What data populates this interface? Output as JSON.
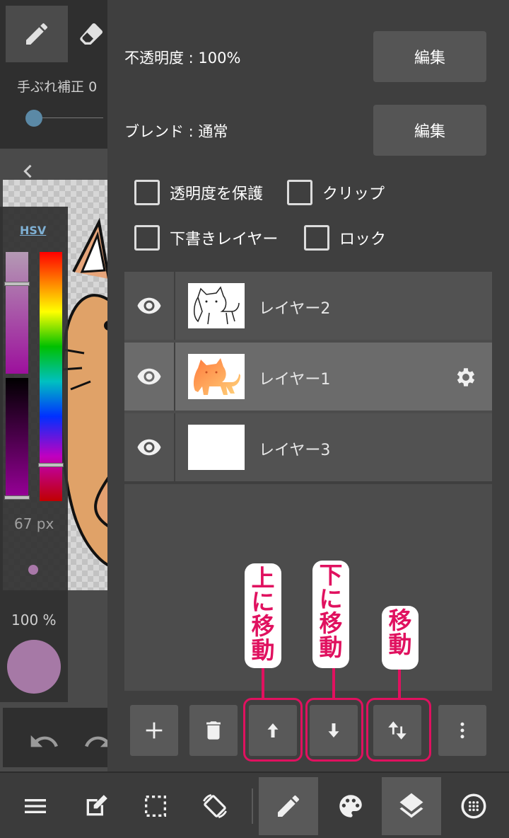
{
  "colors": {
    "accent_callout": "#e0115f",
    "panel_bg": "#3f3f3f",
    "selected_layer": "#6b6b6b",
    "current_color": "#a679a6",
    "hsv_link": "#7fb0d4"
  },
  "left_toolbar": {
    "tools": [
      {
        "icon": "pencil-icon",
        "active": true
      },
      {
        "icon": "eraser-icon",
        "active": false
      }
    ],
    "stabilizer": {
      "label": "手ぶれ補正",
      "value": "0"
    },
    "color_mode_tab": "HSV",
    "brush_size": "67 px",
    "brush_opacity": "100 %",
    "undo_icon": "undo-icon",
    "redo_icon": "redo-icon"
  },
  "layer_properties": {
    "opacity_label": "不透明度 : 100%",
    "blend_label": "ブレンド : 通常",
    "edit_button": "編集",
    "checkboxes": [
      {
        "label": "透明度を保護",
        "checked": false
      },
      {
        "label": "クリップ",
        "checked": false
      },
      {
        "label": "下書きレイヤー",
        "checked": false
      },
      {
        "label": "ロック",
        "checked": false
      }
    ]
  },
  "layers": [
    {
      "name": "レイヤー2",
      "visible": true,
      "selected": false,
      "thumbnail": "white-cat-sketch"
    },
    {
      "name": "レイヤー1",
      "visible": true,
      "selected": true,
      "thumbnail": "orange-cat-color"
    },
    {
      "name": "レイヤー3",
      "visible": true,
      "selected": false,
      "thumbnail": "blank-white"
    }
  ],
  "callouts": {
    "move_up": "上に移動",
    "move_down": "下に移動",
    "move": "移動"
  },
  "layer_actions": [
    {
      "icon": "add-icon"
    },
    {
      "icon": "trash-icon"
    },
    {
      "icon": "arrow-up-icon"
    },
    {
      "icon": "arrow-down-icon"
    },
    {
      "icon": "swap-vertical-icon"
    },
    {
      "icon": "more-vertical-icon"
    }
  ],
  "bottom_nav": [
    {
      "icon": "menu-icon",
      "active": false
    },
    {
      "icon": "edit-canvas-icon",
      "active": false
    },
    {
      "icon": "selection-icon",
      "active": false
    },
    {
      "icon": "rotate-screen-icon",
      "active": false
    },
    {
      "icon": "brush-icon",
      "active": true
    },
    {
      "icon": "palette-icon",
      "active": false
    },
    {
      "icon": "layers-icon",
      "active": true
    },
    {
      "icon": "material-icon",
      "active": false
    }
  ]
}
